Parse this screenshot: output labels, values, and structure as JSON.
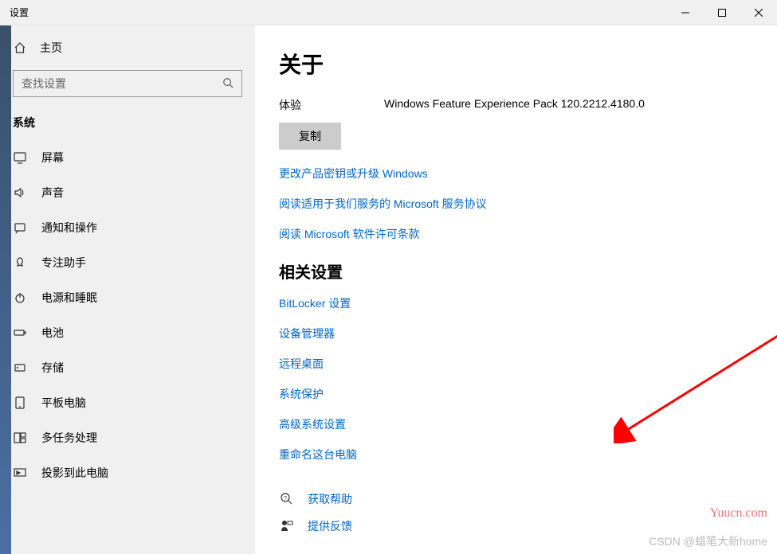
{
  "window": {
    "title": "设置"
  },
  "sidebar": {
    "home": "主页",
    "search_placeholder": "查找设置",
    "section": "系统",
    "items": [
      {
        "label": "屏幕"
      },
      {
        "label": "声音"
      },
      {
        "label": "通知和操作"
      },
      {
        "label": "专注助手"
      },
      {
        "label": "电源和睡眠"
      },
      {
        "label": "电池"
      },
      {
        "label": "存储"
      },
      {
        "label": "平板电脑"
      },
      {
        "label": "多任务处理"
      },
      {
        "label": "投影到此电脑"
      }
    ]
  },
  "main": {
    "title": "关于",
    "info": {
      "experience_label": "体验",
      "experience_value": "Windows Feature Experience Pack 120.2212.4180.0"
    },
    "copy_button": "复制",
    "links1": [
      "更改产品密钥或升级 Windows",
      "阅读适用于我们服务的 Microsoft 服务协议",
      "阅读 Microsoft 软件许可条款"
    ],
    "related_title": "相关设置",
    "links2": [
      "BitLocker 设置",
      "设备管理器",
      "远程桌面",
      "系统保护",
      "高级系统设置",
      "重命名这台电脑"
    ],
    "help": [
      "获取帮助",
      "提供反馈"
    ]
  },
  "watermarks": {
    "csdn": "CSDN @蜡笔大新home",
    "yuucn": "Yuucn.com"
  }
}
